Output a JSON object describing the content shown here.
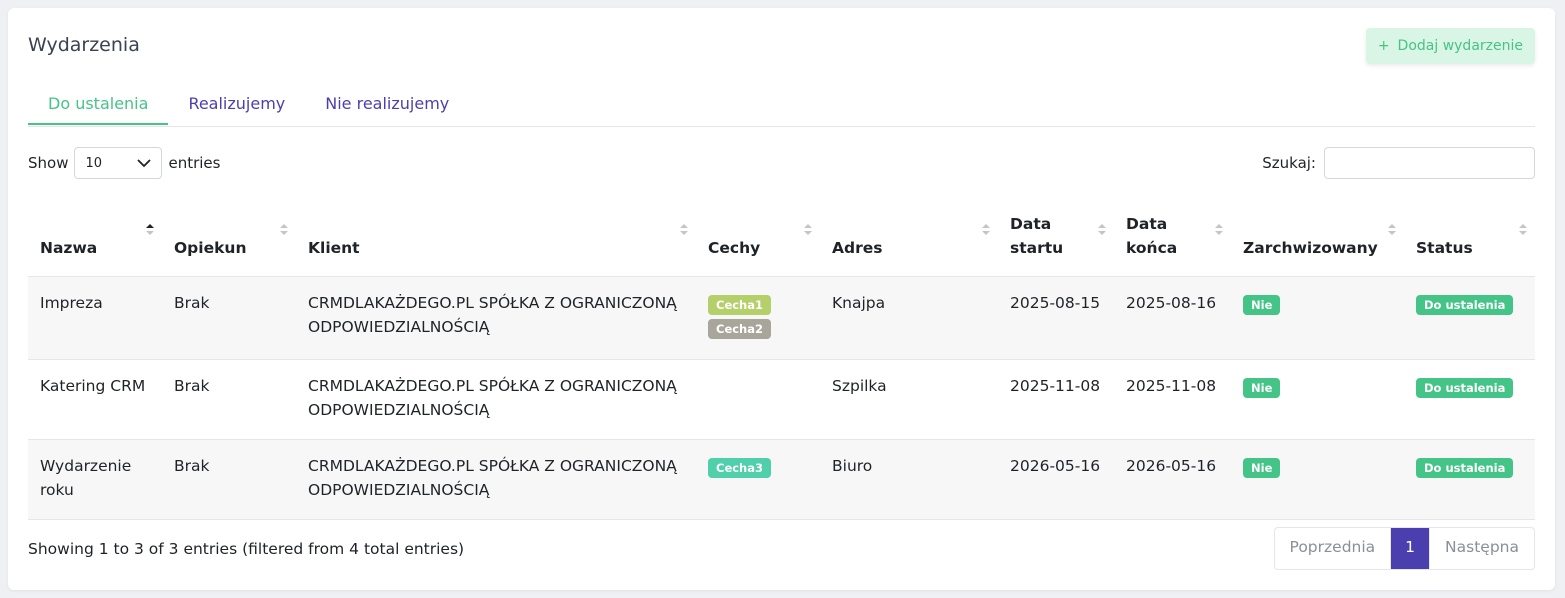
{
  "header": {
    "title": "Wydarzenia",
    "add_button_icon": "+",
    "add_button_label": "Dodaj wydarzenie"
  },
  "tabs": [
    {
      "label": "Do ustalenia",
      "active": true
    },
    {
      "label": "Realizujemy",
      "active": false
    },
    {
      "label": "Nie realizujemy",
      "active": false
    }
  ],
  "length": {
    "show_label": "Show",
    "value": "10",
    "entries_label": "entries"
  },
  "search": {
    "label": "Szukaj:",
    "value": ""
  },
  "table": {
    "columns": [
      "Nazwa",
      "Opiekun",
      "Klient",
      "Cechy",
      "Adres",
      "Data startu",
      "Data końca",
      "Zarchwizowany",
      "Status"
    ],
    "rows": [
      {
        "nazwa": "Impreza",
        "opiekun": "Brak",
        "klient": "CRMDLAKAŻDEGO.PL SPÓŁKA Z OGRANICZONĄ ODPOWIEDZIALNOŚCIĄ",
        "cechy": [
          {
            "label": "Cecha1",
            "color": "#b5cf6b"
          },
          {
            "label": "Cecha2",
            "color": "#a8a69a"
          }
        ],
        "adres": "Knajpa",
        "data_startu": "2025-08-15",
        "data_konca": "2025-08-16",
        "zarchiwizowany": "Nie",
        "status": "Do ustalenia"
      },
      {
        "nazwa": "Katering CRM",
        "opiekun": "Brak",
        "klient": "CRMDLAKAŻDEGO.PL SPÓŁKA Z OGRANICZONĄ ODPOWIEDZIALNOŚCIĄ",
        "cechy": [],
        "adres": "Szpilka",
        "data_startu": "2025-11-08",
        "data_konca": "2025-11-08",
        "zarchiwizowany": "Nie",
        "status": "Do ustalenia"
      },
      {
        "nazwa": "Wydarzenie roku",
        "opiekun": "Brak",
        "klient": "CRMDLAKAŻDEGO.PL SPÓŁKA Z OGRANICZONĄ ODPOWIEDZIALNOŚCIĄ",
        "cechy": [
          {
            "label": "Cecha3",
            "color": "#4fcfaa"
          }
        ],
        "adres": "Biuro",
        "data_startu": "2026-05-16",
        "data_konca": "2026-05-16",
        "zarchiwizowany": "Nie",
        "status": "Do ustalenia"
      }
    ]
  },
  "footer": {
    "info": "Showing 1 to 3 of 3 entries (filtered from 4 total entries)",
    "prev_label": "Poprzednia",
    "current_page": "1",
    "next_label": "Następna"
  }
}
